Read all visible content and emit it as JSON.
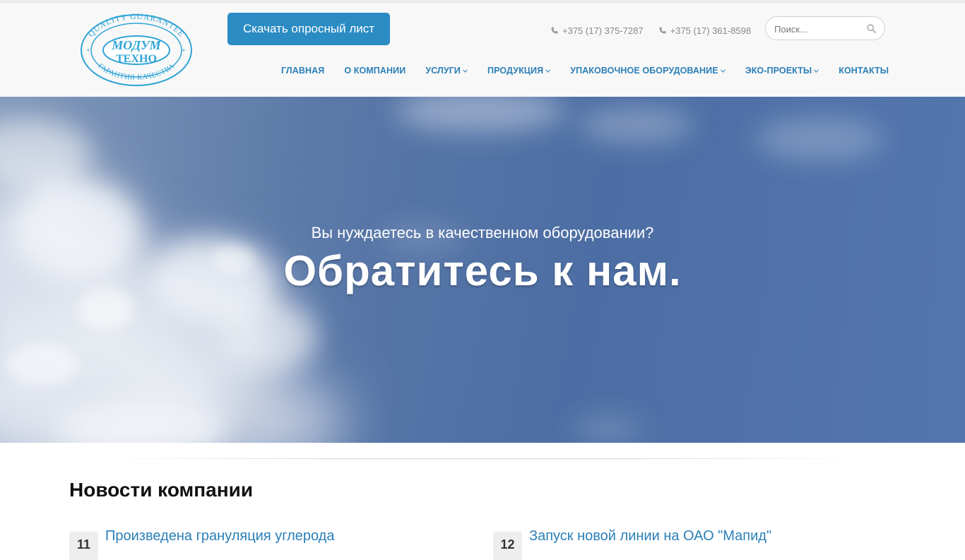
{
  "brand": {
    "name": "Модум Техно",
    "logo_line1": "МОДУМ",
    "logo_line2": "ТЕХНО",
    "logo_ring_top": "QUALITY GUARANTEE",
    "logo_ring_bottom": "ГАРАНТИЯ КАЧЕСТВА"
  },
  "header": {
    "cta_label": "Скачать опросный лист",
    "phones": [
      "+375 (17) 375-7287",
      "+375 (17) 361-8598"
    ],
    "search_placeholder": "Поиск..."
  },
  "nav": {
    "items": [
      {
        "label": "ГЛАВНАЯ",
        "dropdown": false
      },
      {
        "label": "О КОМПАНИИ",
        "dropdown": false
      },
      {
        "label": "УСЛУГИ",
        "dropdown": true
      },
      {
        "label": "ПРОДУКЦИЯ",
        "dropdown": true
      },
      {
        "label": "УПАКОВОЧНОЕ ОБОРУДОВАНИЕ",
        "dropdown": true
      },
      {
        "label": "ЭКО-ПРОЕКТЫ",
        "dropdown": true
      },
      {
        "label": "КОНТАКТЫ",
        "dropdown": false
      }
    ]
  },
  "hero": {
    "subtitle": "Вы нуждаетесь в качественном оборудовании?",
    "title": "Обратитесь к нам."
  },
  "news": {
    "section_title": "Новости компании",
    "items": [
      {
        "day": "11",
        "headline": "Произведена грануляция углерода"
      },
      {
        "day": "12",
        "headline": "Запуск новой линии на ОАО \"Мапид\""
      }
    ]
  },
  "colors": {
    "accent": "#2b7fb8",
    "button": "#2b8cc4",
    "header_bg": "#f8f8f8",
    "hero_sky": "#4d6ea4"
  },
  "icons": {
    "phone": "phone-icon",
    "search": "search-icon",
    "dropdown": "chevron-down-icon"
  }
}
